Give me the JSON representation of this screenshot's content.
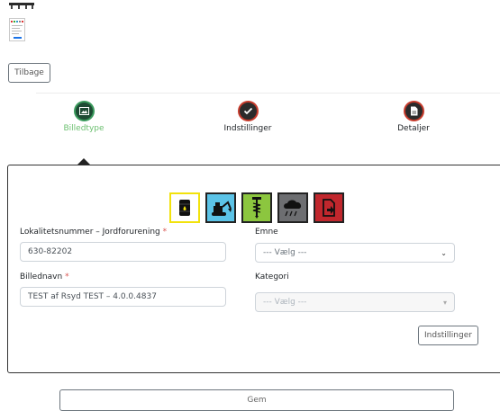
{
  "nav": {
    "back_label": "Tilbage"
  },
  "steps": [
    {
      "label": "Billedtype",
      "icon": "image-icon",
      "state": "active"
    },
    {
      "label": "Indstillinger",
      "icon": "checkmark-icon",
      "state": "inactive"
    },
    {
      "label": "Detaljer",
      "icon": "document-icon",
      "state": "inactive"
    }
  ],
  "image_types": [
    {
      "icon": "oil-barrel-icon",
      "selected": true
    },
    {
      "icon": "excavator-icon",
      "selected": false
    },
    {
      "icon": "drill-icon",
      "selected": false
    },
    {
      "icon": "rain-cloud-icon",
      "selected": false
    },
    {
      "icon": "document-arrow-icon",
      "selected": false
    }
  ],
  "form": {
    "locality_label": "Lokalitetsnummer – Jordforurening",
    "locality_required": "*",
    "locality_value": "630-82202",
    "image_name_label": "Billednavn",
    "image_name_required": "*",
    "image_name_value": "TEST af Rsyd TEST – 4.0.0.4837",
    "subject_label": "Emne",
    "subject_value": "--- Vælg ---",
    "category_label": "Kategori",
    "category_value": "--- Vælg ---",
    "settings_button": "Indstillinger"
  },
  "footer": {
    "save_label": "Gem"
  },
  "colors": {
    "active_step": "#6cc070",
    "step_ring": "#c63b2c",
    "required": "#d9534f"
  }
}
